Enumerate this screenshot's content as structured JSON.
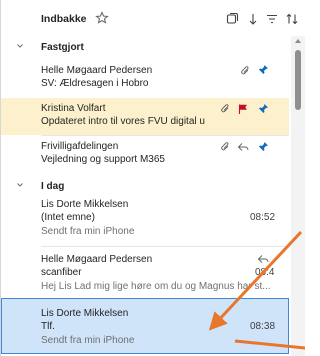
{
  "header": {
    "folder_title": "Indbakke",
    "icons": [
      "star-outline-icon",
      "select-icon",
      "sort-arrow-down-icon",
      "filter-icon",
      "sort-icon"
    ]
  },
  "groups": {
    "pinned": "Fastgjort",
    "today": "I dag"
  },
  "messages": [
    {
      "sender": "Helle Møgaard Pedersen",
      "subject": "SV: Ældresagen i Hobro",
      "icons": [
        "paperclip-icon",
        "pin-icon"
      ]
    },
    {
      "sender": "Kristina Volfart",
      "subject": "Opdateret intro til vores FVU digital u",
      "icons": [
        "paperclip-icon",
        "flag-icon",
        "pin-icon"
      ],
      "highlight": "#fcf1cc",
      "flag_color": "#c50f1f"
    },
    {
      "sender": "Frivilligafdelingen",
      "subject": "Vejledning og support M365",
      "icons": [
        "paperclip-icon",
        "reply-icon",
        "pin-icon"
      ]
    },
    {
      "sender": "Lis Dorte Mikkelsen",
      "subject": "(Intet emne)",
      "preview": "Sendt fra min iPhone",
      "time": "08:52"
    },
    {
      "sender": "Helle Møgaard Pedersen",
      "subject": "scanfiber",
      "preview": "Hej Lis Lad mig lige høre om du og Magnus har st...",
      "time": "08:4",
      "icons": [
        "reply-icon"
      ]
    },
    {
      "sender": "Lis Dorte Mikkelsen",
      "subject": "Tlf.",
      "preview": "Sendt fra min iPhone",
      "time": "08:38",
      "selected": true
    }
  ],
  "colors": {
    "accent": "#0f6cbd",
    "annotation_arrow": "#e8762b",
    "selected_bg": "#cfe3f9",
    "pinned_highlight": "#fcf1cc"
  }
}
